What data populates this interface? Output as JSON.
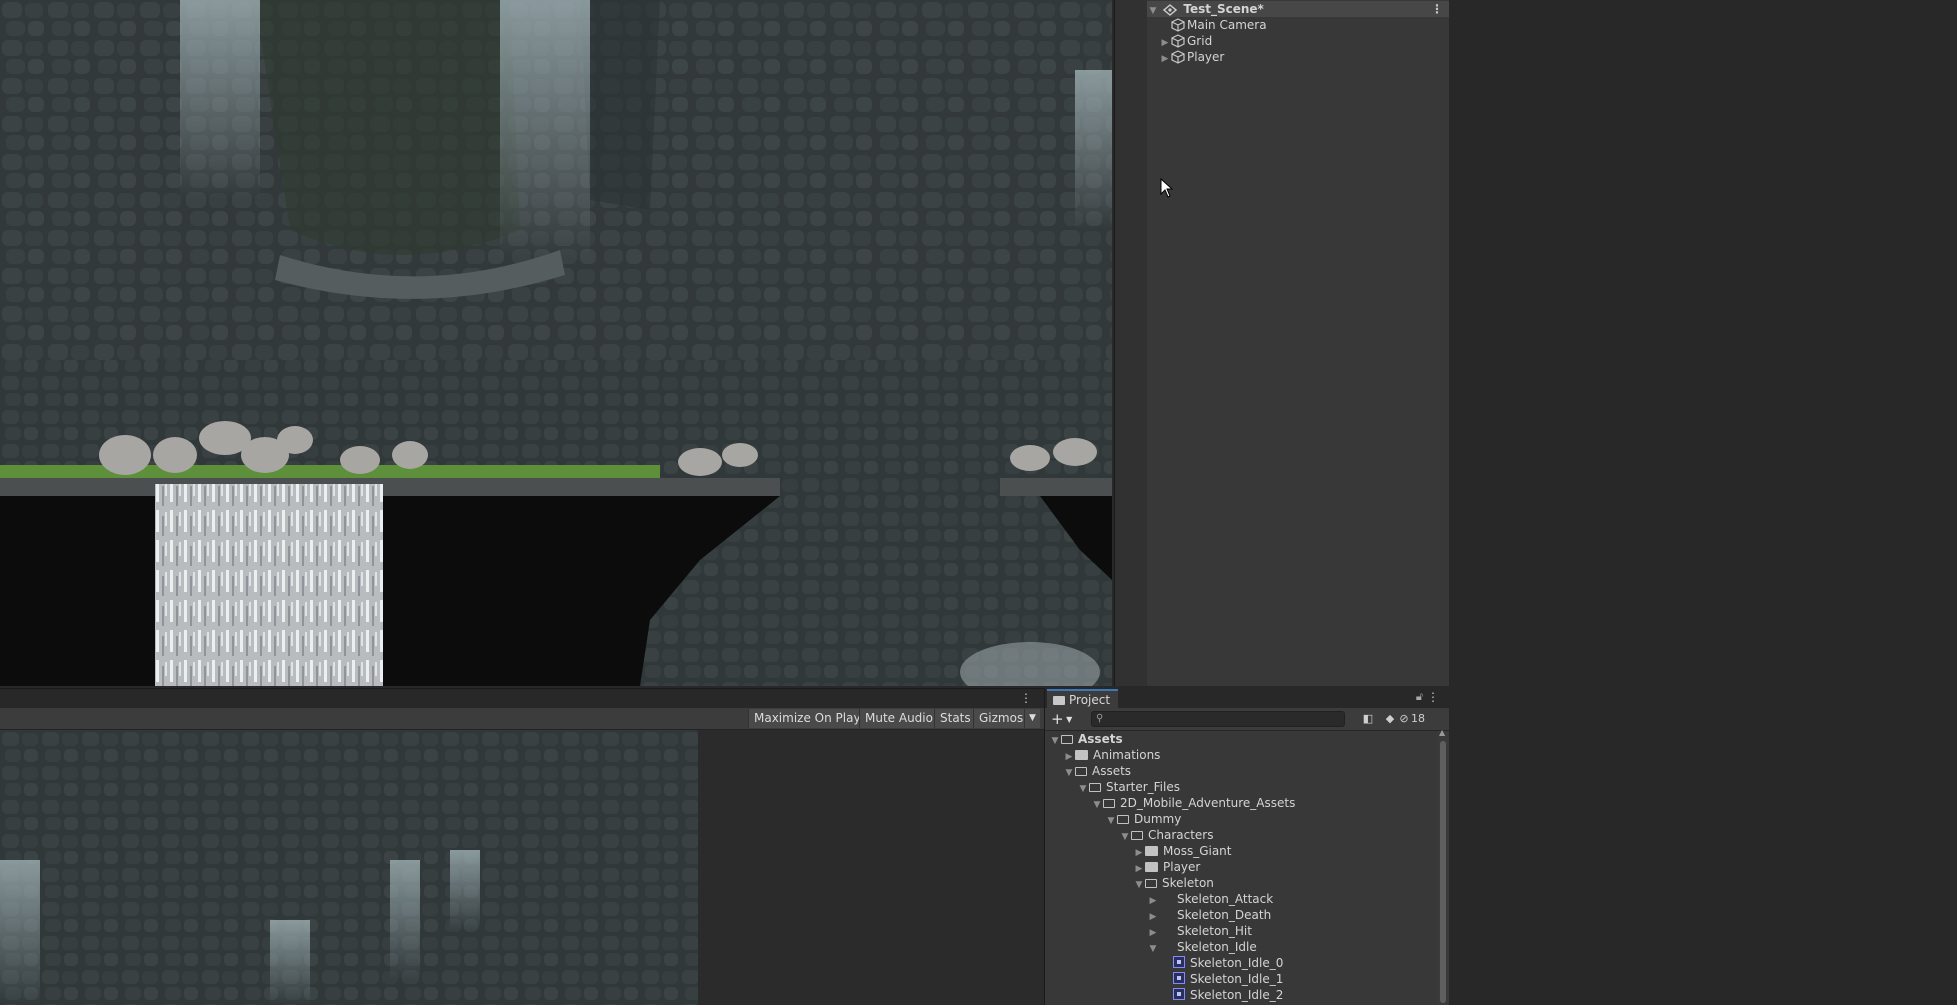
{
  "hierarchy": {
    "scene_name": "Test_Scene*",
    "objects": [
      {
        "label": "Main Camera",
        "expandable": false
      },
      {
        "label": "Grid",
        "expandable": true
      },
      {
        "label": "Player",
        "expandable": true
      }
    ]
  },
  "game_view": {
    "toolbar": {
      "maximize_label": "Maximize On Play",
      "mute_label": "Mute Audio",
      "stats_label": "Stats",
      "gizmos_label": "Gizmos"
    }
  },
  "project": {
    "tab_label": "Project",
    "search_placeholder": "",
    "hidden_packages_count": "18",
    "tree": [
      {
        "label": "Assets",
        "depth": 0,
        "state": "open",
        "icon": "folder-open-icon",
        "bold": true
      },
      {
        "label": "Animations",
        "depth": 1,
        "state": "closed",
        "icon": "folder-icon"
      },
      {
        "label": "Assets",
        "depth": 1,
        "state": "open",
        "icon": "folder-open-icon"
      },
      {
        "label": "Starter_Files",
        "depth": 2,
        "state": "open",
        "icon": "folder-open-icon"
      },
      {
        "label": "2D_Mobile_Adventure_Assets",
        "depth": 3,
        "state": "open",
        "icon": "folder-open-icon"
      },
      {
        "label": "Dummy",
        "depth": 4,
        "state": "open",
        "icon": "folder-open-icon"
      },
      {
        "label": "Characters",
        "depth": 5,
        "state": "open",
        "icon": "folder-open-icon"
      },
      {
        "label": "Moss_Giant",
        "depth": 6,
        "state": "closed",
        "icon": "folder-icon"
      },
      {
        "label": "Player",
        "depth": 6,
        "state": "closed",
        "icon": "folder-icon"
      },
      {
        "label": "Skeleton",
        "depth": 6,
        "state": "open",
        "icon": "folder-open-icon"
      },
      {
        "label": "Skeleton_Attack",
        "depth": 7,
        "state": "closed",
        "icon": "sprite-sheet-icon"
      },
      {
        "label": "Skeleton_Death",
        "depth": 7,
        "state": "closed",
        "icon": "sprite-sheet-icon"
      },
      {
        "label": "Skeleton_Hit",
        "depth": 7,
        "state": "closed",
        "icon": "sprite-sheet-icon"
      },
      {
        "label": "Skeleton_Idle",
        "depth": 7,
        "state": "open",
        "icon": "sprite-sheet-icon"
      },
      {
        "label": "Skeleton_Idle_0",
        "depth": 8,
        "state": "leaf",
        "icon": "sprite-icon"
      },
      {
        "label": "Skeleton_Idle_1",
        "depth": 8,
        "state": "leaf",
        "icon": "sprite-icon"
      },
      {
        "label": "Skeleton_Idle_2",
        "depth": 8,
        "state": "leaf",
        "icon": "sprite-icon"
      }
    ]
  },
  "colors": {
    "editor_dark": "#282828",
    "panel": "#383838",
    "selection_accent": "#3a79bb",
    "sprite_icon": "#7e8cff"
  }
}
